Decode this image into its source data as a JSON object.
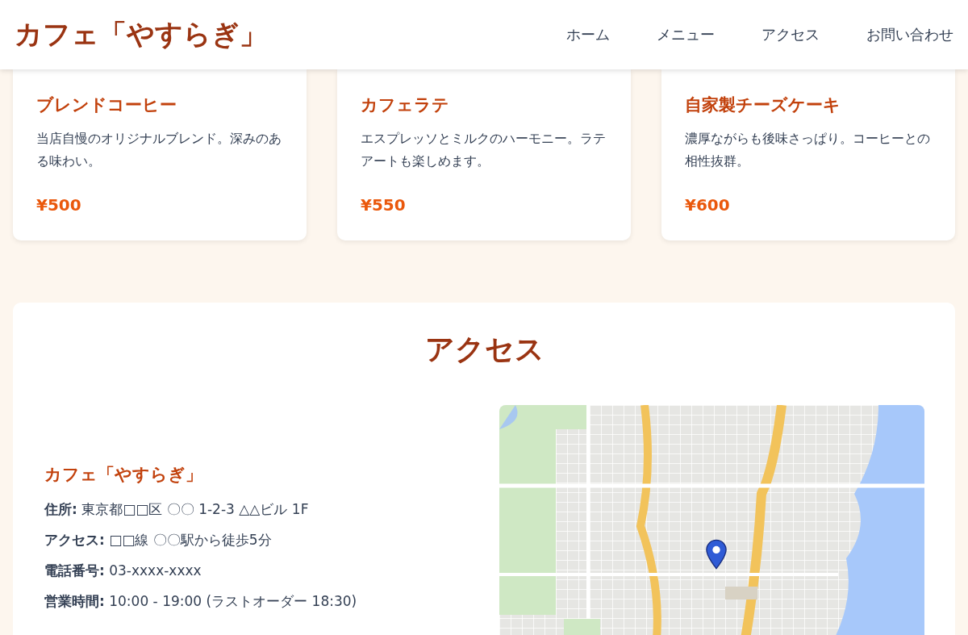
{
  "header": {
    "logo": "カフェ「やすらぎ」",
    "nav": [
      {
        "label": "ホーム"
      },
      {
        "label": "メニュー"
      },
      {
        "label": "アクセス"
      },
      {
        "label": "お問い合わせ"
      }
    ]
  },
  "menu_items": [
    {
      "name": "ブレンドコーヒー",
      "description": "当店自慢のオリジナルブレンド。深みのある味わい。",
      "price": "¥500"
    },
    {
      "name": "カフェラテ",
      "description": "エスプレッソとミルクのハーモニー。ラテアートも楽しめます。",
      "price": "¥550"
    },
    {
      "name": "自家製チーズケーキ",
      "description": "濃厚ながらも後味さっぱり。コーヒーとの相性抜群。",
      "price": "¥600"
    }
  ],
  "access": {
    "title": "アクセス",
    "shop_name": "カフェ「やすらぎ」",
    "details": [
      "**住所:** 東京都□□区 〇〇 1-2-3 △△ビル 1F",
      "**アクセス:** □□線 〇〇駅から徒歩5分",
      "**電話番号:** 03-xxxx-xxxx",
      "**営業時間:** 10:00 - 19:00 (ラストオーダー 18:30)"
    ]
  }
}
